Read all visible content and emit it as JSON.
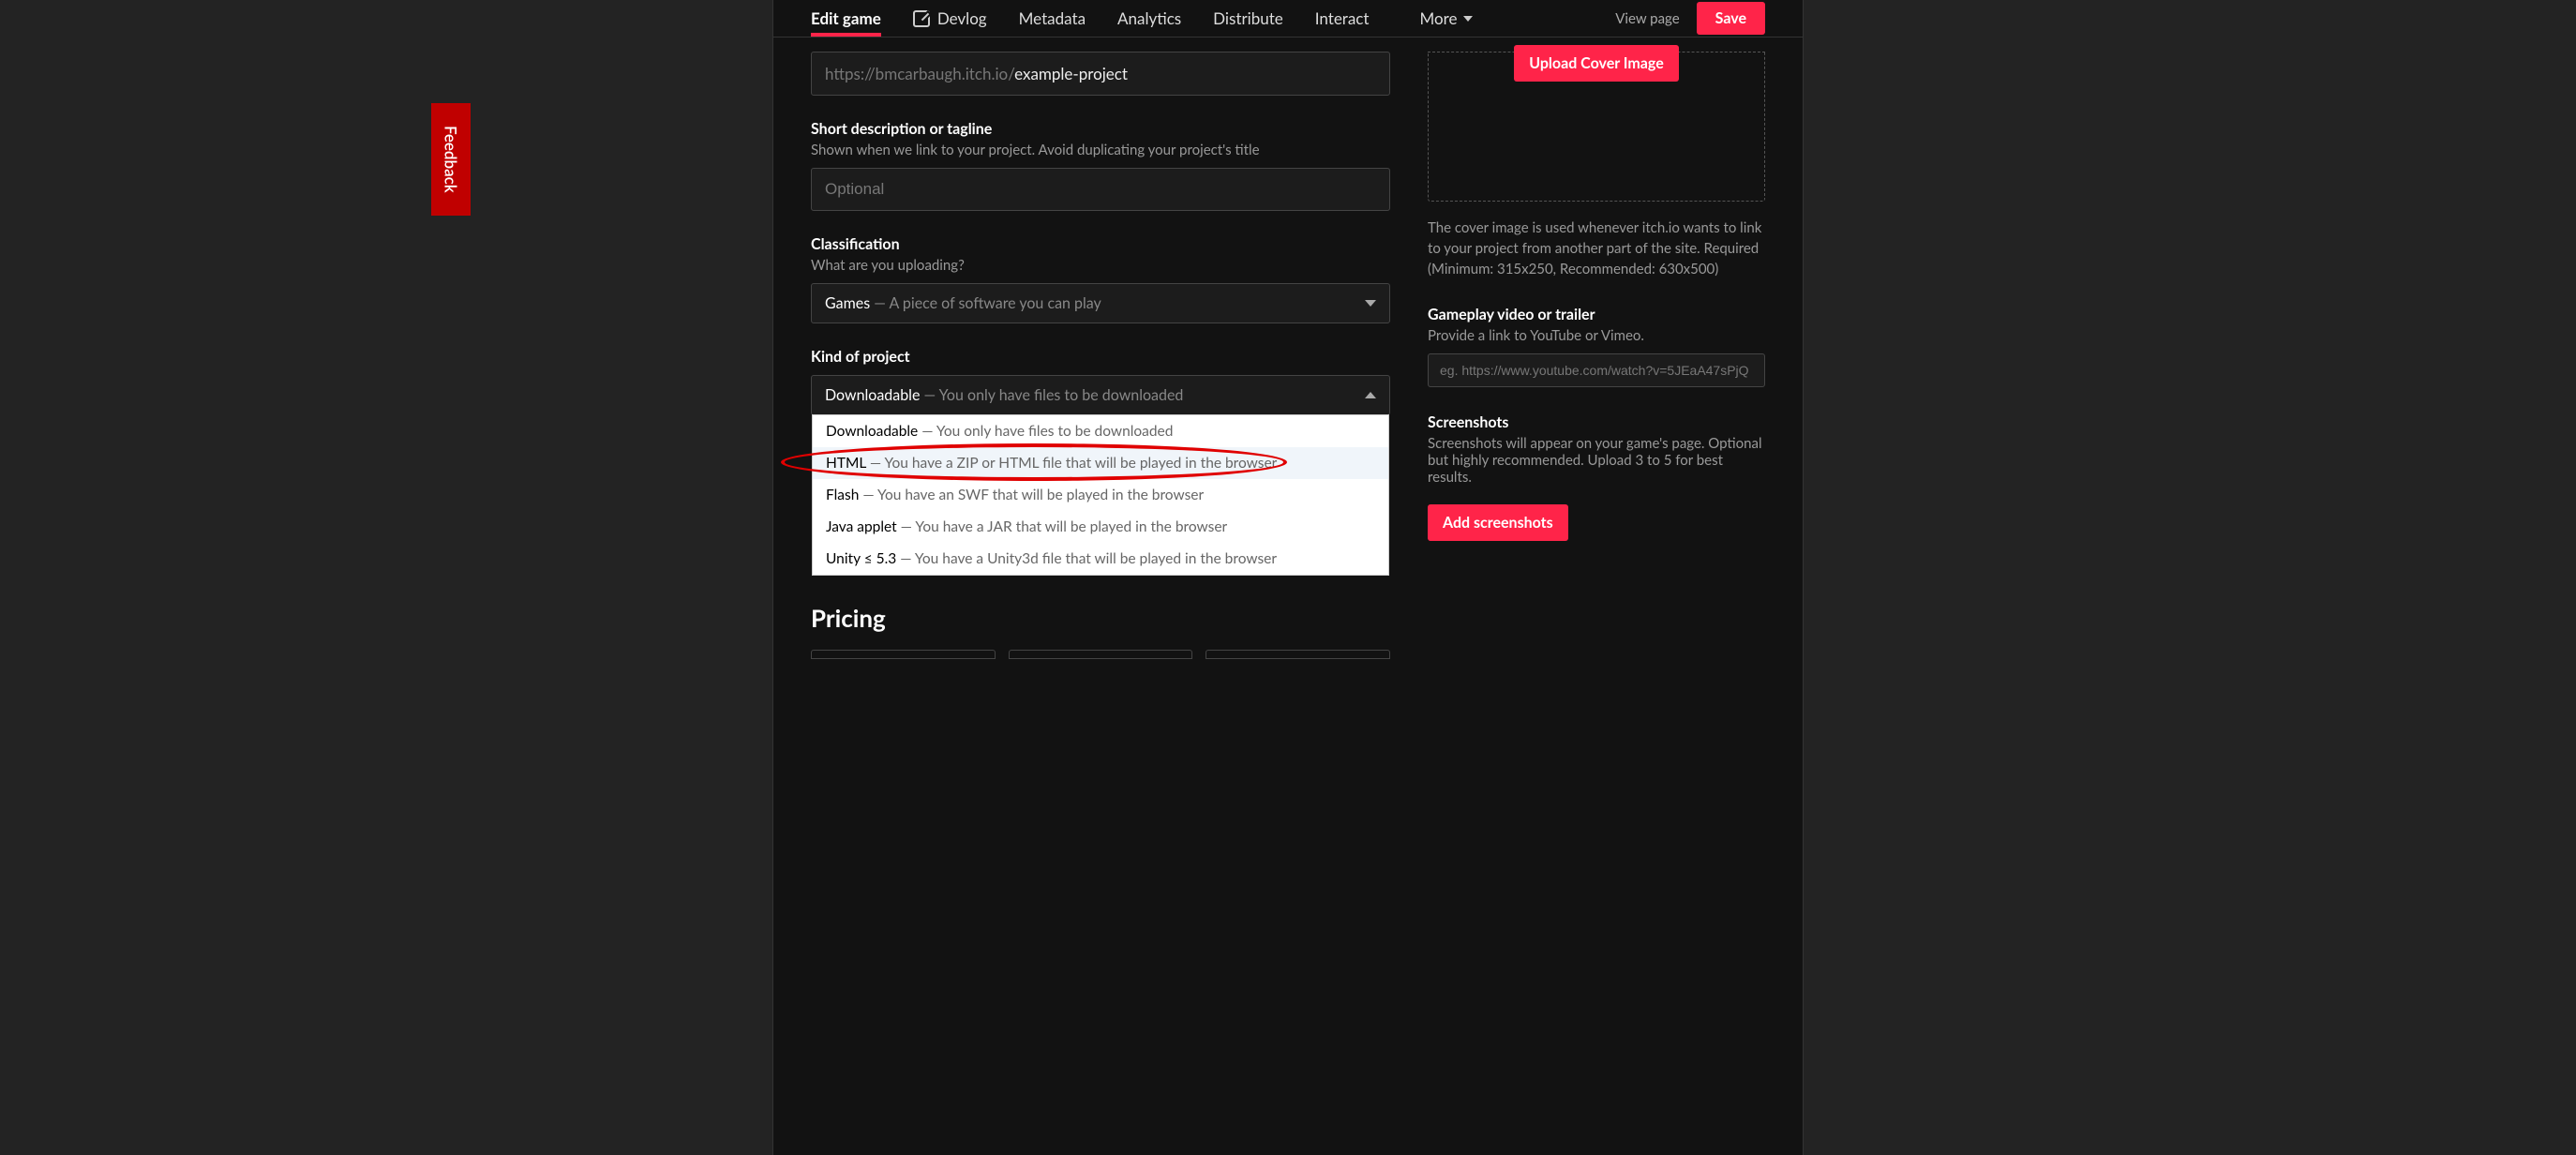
{
  "feedback": {
    "label": "Feedback"
  },
  "tabs": {
    "items": [
      {
        "label": "Edit game",
        "active": true
      },
      {
        "label": "Devlog"
      },
      {
        "label": "Metadata"
      },
      {
        "label": "Analytics"
      },
      {
        "label": "Distribute"
      },
      {
        "label": "Interact"
      },
      {
        "label": "More"
      }
    ],
    "view_page": "View page",
    "save": "Save"
  },
  "url_field": {
    "prefix": "https://bmcarbaugh.itch.io/",
    "slug": "example-project"
  },
  "short_desc": {
    "label": "Short description or tagline",
    "sub": "Shown when we link to your project. Avoid duplicating your project's title",
    "placeholder": "Optional"
  },
  "classification": {
    "label": "Classification",
    "sub": "What are you uploading?",
    "selected_main": "Games",
    "selected_sep": " — ",
    "selected_desc": "A piece of software you can play"
  },
  "kind": {
    "label": "Kind of project",
    "selected_main": "Downloadable",
    "selected_sep": " — ",
    "selected_desc": "You only have files to be downloaded",
    "options": [
      {
        "main": "Downloadable",
        "sep": " — ",
        "desc": "You only have files to be downloaded"
      },
      {
        "main": "HTML",
        "sep": " — ",
        "desc": "You have a ZIP or HTML file that will be played in the browser"
      },
      {
        "main": "Flash",
        "sep": " — ",
        "desc": "You have an SWF that will be played in the browser"
      },
      {
        "main": "Java applet",
        "sep": " — ",
        "desc": "You have a JAR that will be played in the browser"
      },
      {
        "main": "Unity ≤ 5.3",
        "sep": " — ",
        "desc": "You have a Unity3d file that will be played in the browser"
      }
    ]
  },
  "pricing": {
    "heading": "Pricing"
  },
  "right": {
    "cover": {
      "button": "Upload Cover Image",
      "note": "The cover image is used whenever itch.io wants to link to your project from another part of the site. Required (Minimum: 315x250, Recommended: 630x500)"
    },
    "video": {
      "label": "Gameplay video or trailer",
      "sub": "Provide a link to YouTube or Vimeo.",
      "placeholder": "eg. https://www.youtube.com/watch?v=5JEaA47sPjQ"
    },
    "screenshots": {
      "label": "Screenshots",
      "sub": "Screenshots will appear on your game's page. Optional but highly recommended. Upload 3 to 5 for best results.",
      "button": "Add screenshots"
    }
  }
}
